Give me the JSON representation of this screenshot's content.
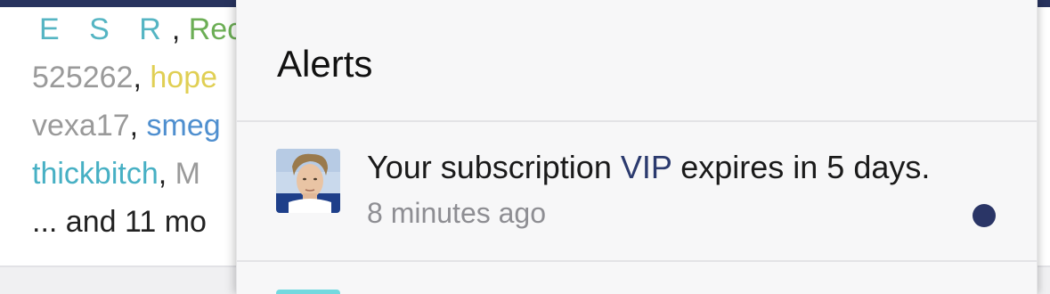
{
  "background": {
    "lines": [
      [
        {
          "text": "E S R",
          "color": "esr"
        },
        {
          "text": ", ",
          "color": "sep"
        },
        {
          "text": "Recc",
          "color": "green"
        }
      ],
      [
        {
          "text": "525262",
          "color": "gray"
        },
        {
          "text": ", ",
          "color": "sep"
        },
        {
          "text": "hope",
          "color": "yellow"
        }
      ],
      [
        {
          "text": "vexa17",
          "color": "gray"
        },
        {
          "text": ", ",
          "color": "sep"
        },
        {
          "text": "smeg",
          "color": "blue"
        }
      ],
      [
        {
          "text": "thickbitch",
          "color": "teal"
        },
        {
          "text": ", ",
          "color": "sep"
        },
        {
          "text": "M",
          "color": "gray"
        }
      ],
      [
        {
          "text": "... and 11 mo",
          "color": "dark"
        }
      ]
    ]
  },
  "alerts": {
    "title": "Alerts",
    "items": [
      {
        "text_before": "Your subscription ",
        "link": "VIP",
        "text_after": " expires in 5 days.",
        "time": "8 minutes ago",
        "unread": true,
        "avatar_icon": "user-avatar"
      }
    ]
  },
  "colors": {
    "accent": "#28335e",
    "link": "#2b3a6e",
    "unread_dot": "#2a3566"
  }
}
